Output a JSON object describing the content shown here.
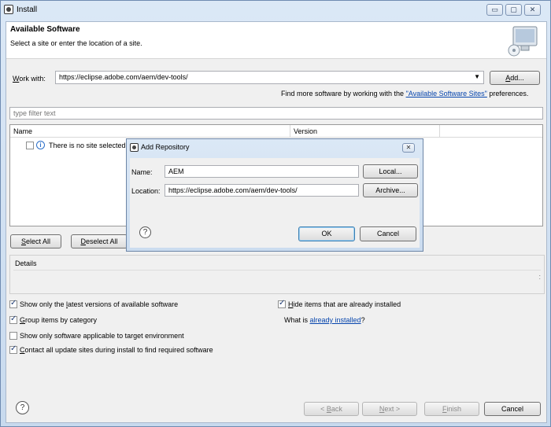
{
  "window": {
    "title": "Install",
    "minimize_glyph": "▭",
    "maximize_glyph": "▢",
    "close_glyph": "✕"
  },
  "header": {
    "title": "Available Software",
    "subtitle": "Select a site or enter the location of a site."
  },
  "work_with": {
    "label_prefix": "W",
    "label_rest": "ork with:",
    "value": "https://eclipse.adobe.com/aem/dev-tools/",
    "add_button_prefix": "A",
    "add_button_rest": "dd..."
  },
  "find_more": {
    "prefix": "Find more software by working with the ",
    "link": "\"Available Software Sites\"",
    "suffix": " preferences."
  },
  "filter": {
    "placeholder": "type filter text"
  },
  "table": {
    "columns": [
      "Name",
      "Version"
    ],
    "rows": [
      {
        "name": "There is no site selected."
      }
    ]
  },
  "list_buttons": {
    "select_all_prefix": "S",
    "select_all_rest": "elect All",
    "deselect_all_prefix": "D",
    "deselect_all_rest": "eselect All"
  },
  "details": {
    "label": "Details"
  },
  "options": {
    "latest": {
      "pre": "Show only the ",
      "u": "l",
      "post": "atest versions of available software",
      "checked": true
    },
    "group": {
      "pre": "",
      "u": "G",
      "post": "roup items by category",
      "checked": true
    },
    "target_env": {
      "pre": "Show only software applicable to target environment",
      "u": "",
      "post": "",
      "checked": false
    },
    "contact": {
      "pre": "",
      "u": "C",
      "post": "ontact all update sites during install to find required software",
      "checked": true
    },
    "hide": {
      "pre": "",
      "u": "H",
      "post": "ide items that are already installed",
      "checked": true
    },
    "what_is_prefix": "What is ",
    "what_is_link": "already installed",
    "what_is_suffix": "?"
  },
  "footer": {
    "help_glyph": "?",
    "back_prefix": "< ",
    "back_u": "B",
    "back_rest": "ack",
    "next_u": "N",
    "next_rest": "ext >",
    "finish_u": "F",
    "finish_rest": "inish",
    "cancel": "Cancel"
  },
  "dialog": {
    "title": "Add Repository",
    "close_glyph": "✕",
    "name_label": "Name:",
    "name_value": "AEM",
    "local_button": "Local...",
    "location_label": "Location:",
    "location_value": "https://eclipse.adobe.com/aem/dev-tools/",
    "archive_button": "Archive...",
    "help_glyph": "?",
    "ok_button": "OK",
    "cancel_button": "Cancel"
  },
  "colors": {
    "link": "#0645ad",
    "info_icon": "#2c6fc9"
  }
}
